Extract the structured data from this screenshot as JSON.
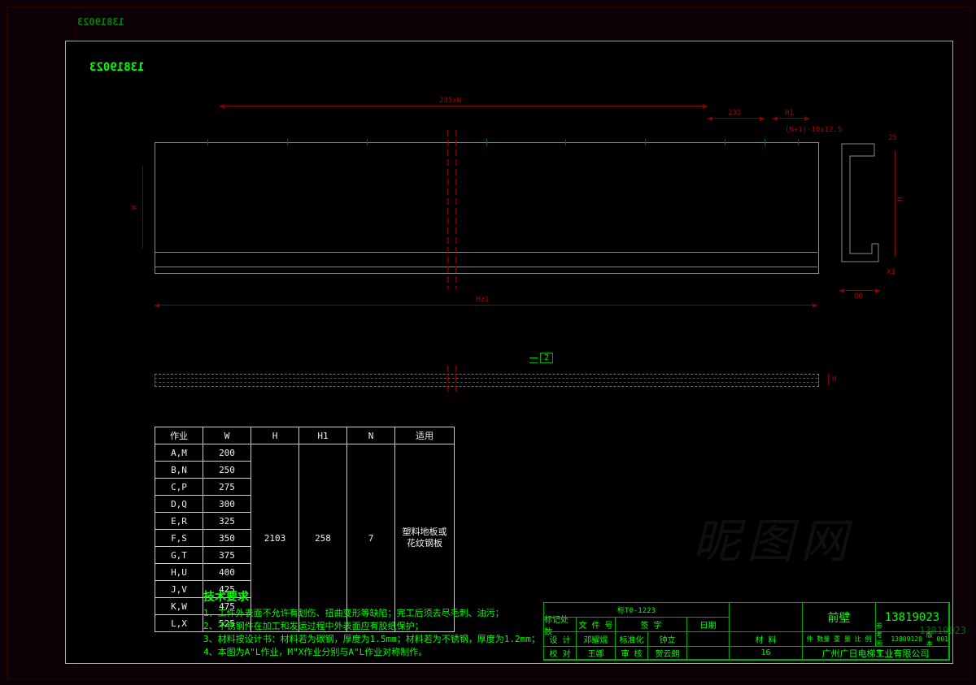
{
  "drawing_number": "13819023",
  "ghost_number_tl": "13819023",
  "ghost_number_br": "13819023",
  "dimensions": {
    "top_span": "235xN",
    "top_235": "235",
    "top_h1": "H1",
    "top_formula": "(N+1)-10x12.5",
    "side_25": "25",
    "side_h": "H",
    "side_x": "X1",
    "side_80": "80",
    "left_w": "W",
    "bottom_h1": "Hz1",
    "bar_h": "H",
    "balloon": "2"
  },
  "param_table": {
    "headers": [
      "作业",
      "W",
      "H",
      "H1",
      "N",
      "适用"
    ],
    "rows": [
      [
        "A,M",
        "200"
      ],
      [
        "B,N",
        "250"
      ],
      [
        "C,P",
        "275"
      ],
      [
        "D,Q",
        "300"
      ],
      [
        "E,R",
        "325"
      ],
      [
        "F,S",
        "350"
      ],
      [
        "G,T",
        "375"
      ],
      [
        "H,U",
        "400"
      ],
      [
        "J,V",
        "425"
      ],
      [
        "K,W",
        "475"
      ],
      [
        "L,X",
        "525"
      ]
    ],
    "H_value": "2103",
    "H1_value": "258",
    "N_value": "7",
    "applicable": "塑料地板或花纹钢板"
  },
  "tech_req": {
    "title": "技术要求",
    "items": [
      "1、工件外表面不允许有划伤、扭曲变形等缺陷；完工后须去尽毛刺、油污；",
      "2、不锈钢件在加工和发运过程中外表面应有胶纸保护；",
      "3、材料按设计书：材料若为碳钢，厚度为1.5mm；材料若为不锈钢，厚度为1.2mm；",
      "4、本图为A\"L作业，M\"X作业分别与A\"L作业对称制作。"
    ]
  },
  "titleblock": {
    "proj_code": "标T0-1223",
    "hdr_mark": "标记处数",
    "hdr_file": "文 件 号",
    "hdr_sign": "签 字",
    "hdr_date": "日期",
    "des_lbl": "设  计",
    "des_name": "邓耀焜",
    "std_lbl": "标准化",
    "std_name": "钟立",
    "chk_lbl": "校  对",
    "chk_name": "王娜",
    "aud_lbl": "审  核",
    "aud_name": "贺云朗",
    "part_name": "前壁",
    "mat_lbl": "材  料",
    "dwg_no_lbl": "参考图号",
    "dwg_no": "13809120",
    "ver_lbl": "版本",
    "ver": "001",
    "qty_lbl": "件  数量  重 量  比  例",
    "fmt": "16",
    "company": "广州广日电梯工业有限公司"
  },
  "watermark": "昵图网"
}
